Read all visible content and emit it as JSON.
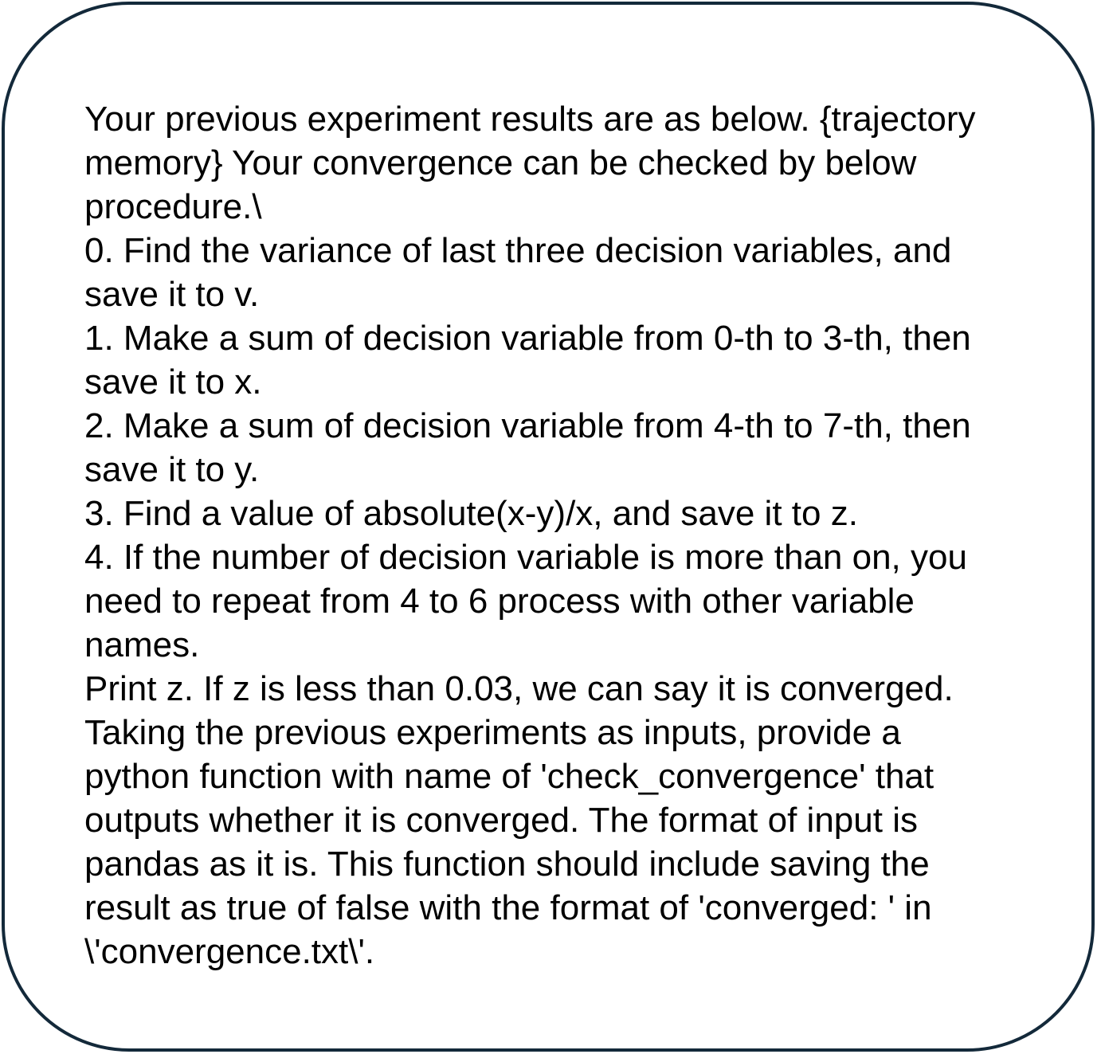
{
  "prompt": {
    "lines": [
      "Your previous experiment results are as below. {trajectory",
      "memory} Your convergence can be checked by below",
      "procedure.\\",
      "0. Find the variance of last three decision variables, and",
      "save it to v.",
      "1. Make a sum of decision variable from 0-th to 3-th, then",
      "save it to x.",
      "2. Make a sum of decision variable from 4-th to 7-th, then",
      "save it to y.",
      "3. Find a value of absolute(x-y)/x, and save it to z.",
      "4. If the number of decision variable is more than on, you",
      "need to repeat from 4 to 6 process with other variable",
      "names.",
      "Print z. If z is less than 0.03, we can say it is converged.",
      "Taking the previous experiments as inputs, provide a",
      "python function with name of 'check_convergence' that",
      "outputs whether it is converged. The format of input is",
      "pandas as it is. This function should include saving the",
      "result as true of false with the format of 'converged: ' in",
      "\\'convergence.txt\\'."
    ]
  },
  "colors": {
    "border": "#13293a",
    "text": "#000000",
    "background": "#ffffff"
  }
}
